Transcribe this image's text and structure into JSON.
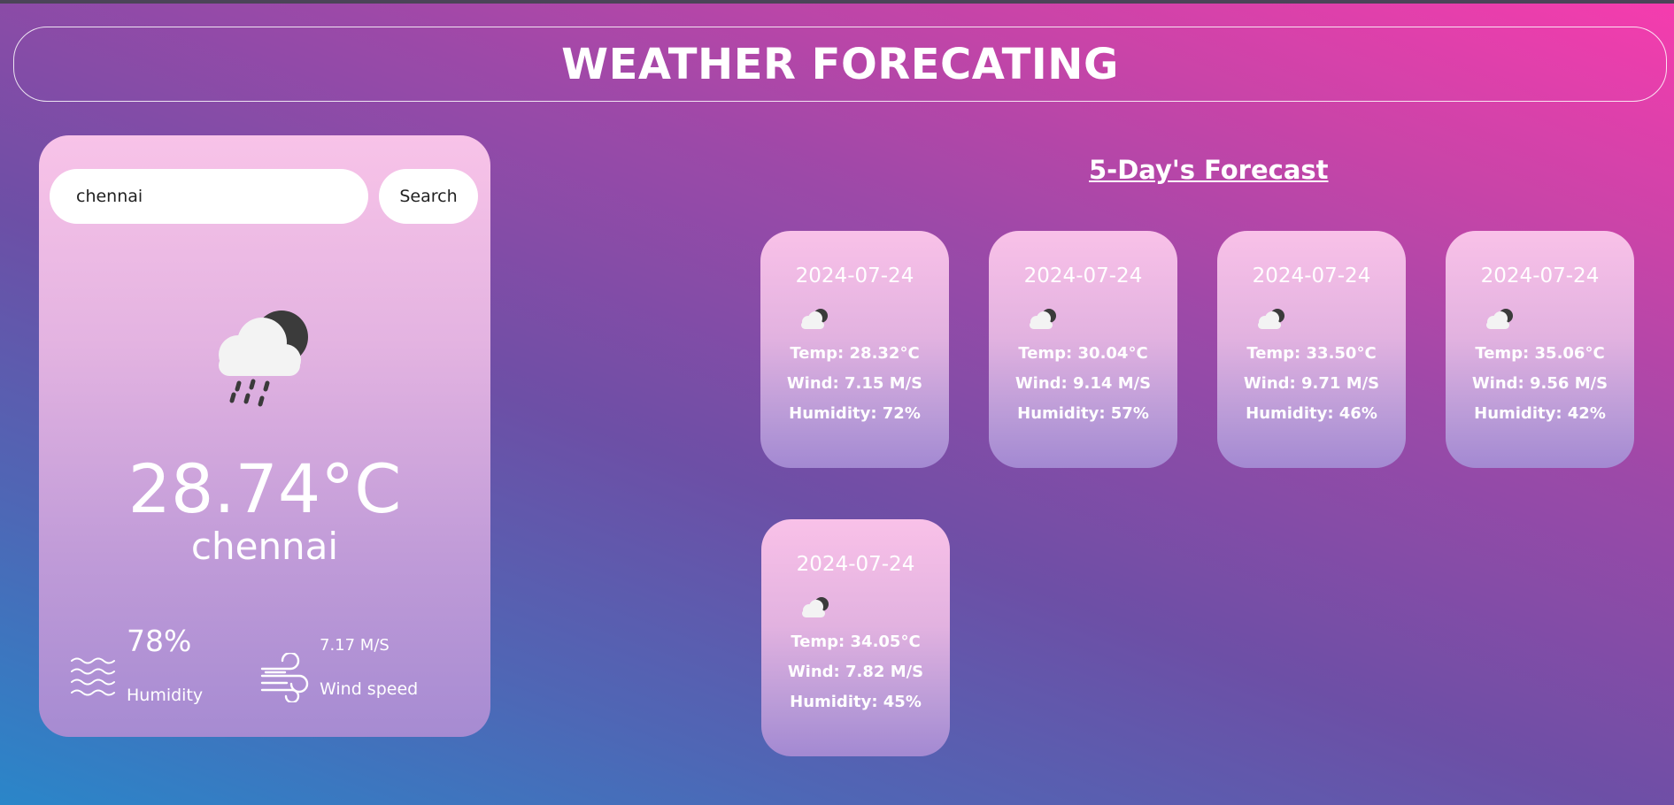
{
  "header": {
    "title": "WEATHER FORECATING"
  },
  "search": {
    "value": "chennai",
    "button_label": "Search"
  },
  "current": {
    "icon": "cloud-rain-moon-icon",
    "temperature": "28.74°C",
    "city": "chennai",
    "humidity_value": "78%",
    "humidity_label": "Humidity",
    "wind_value": "7.17 M/S",
    "wind_label": "Wind speed"
  },
  "forecast": {
    "title": "5-Day's Forecast",
    "days": [
      {
        "date": "2024-07-24",
        "icon": "cloud-moon-icon",
        "temp": "Temp: 28.32°C",
        "wind": "Wind: 7.15 M/S",
        "humidity": "Humidity: 72%"
      },
      {
        "date": "2024-07-24",
        "icon": "cloud-moon-icon",
        "temp": "Temp: 30.04°C",
        "wind": "Wind: 9.14 M/S",
        "humidity": "Humidity: 57%"
      },
      {
        "date": "2024-07-24",
        "icon": "cloud-moon-icon",
        "temp": "Temp: 33.50°C",
        "wind": "Wind: 9.71 M/S",
        "humidity": "Humidity: 46%"
      },
      {
        "date": "2024-07-24",
        "icon": "cloud-moon-icon",
        "temp": "Temp: 35.06°C",
        "wind": "Wind: 9.56 M/S",
        "humidity": "Humidity: 42%"
      },
      {
        "date": "2024-07-24",
        "icon": "cloud-moon-icon",
        "temp": "Temp: 34.05°C",
        "wind": "Wind: 7.82 M/S",
        "humidity": "Humidity: 45%"
      }
    ]
  },
  "colors": {
    "card_top": "#f8c3e8",
    "card_bottom": "#a68bd2",
    "bg_left": "#2a86c9",
    "bg_right": "#f63cae"
  }
}
